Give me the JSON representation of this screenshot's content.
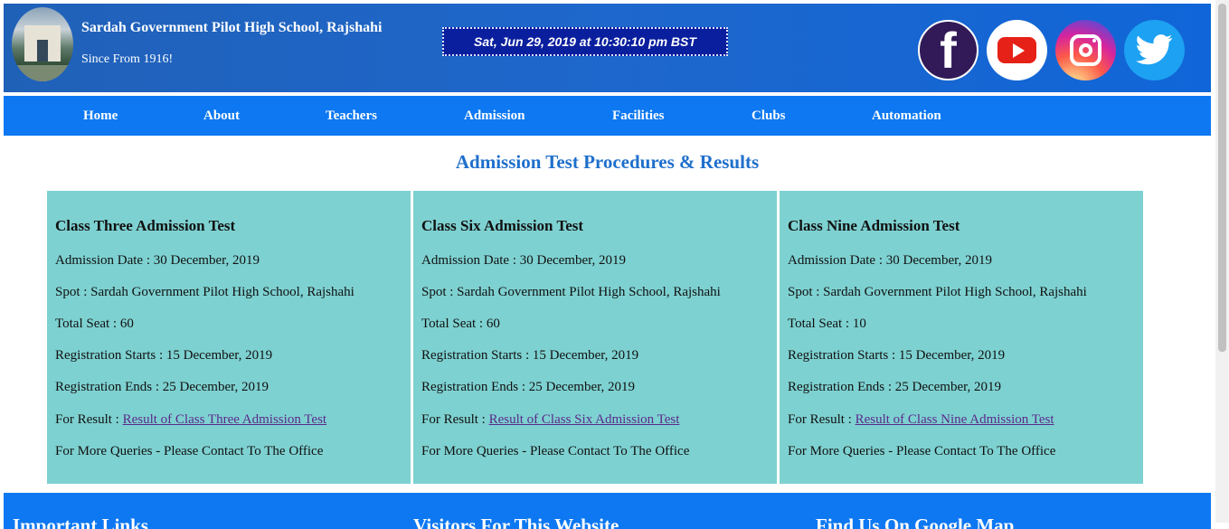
{
  "header": {
    "school_name": "Sardah Government Pilot High School, Rajshahi",
    "since": "Since From 1916!",
    "clock": "Sat, Jun 29, 2019 at 10:30:10 pm BST",
    "social": [
      {
        "name": "facebook-icon",
        "glyph": "f",
        "color": "#311a57"
      },
      {
        "name": "youtube-icon",
        "color": "#e62117"
      },
      {
        "name": "instagram-icon",
        "color": "#d6249f"
      },
      {
        "name": "twitter-icon",
        "color": "#1da1f2"
      }
    ]
  },
  "nav": {
    "items": [
      "Home",
      "About",
      "Teachers",
      "Admission",
      "Facilities",
      "Clubs",
      "Automation"
    ]
  },
  "main": {
    "title": "Admission Test Procedures & Results",
    "cards": [
      {
        "title": "Class Three Admission Test",
        "date": "Admission Date : 30 December, 2019",
        "spot": "Spot : Sardah Government Pilot High School, Rajshahi",
        "seat": "Total Seat : 60",
        "reg_start": "Registration Starts : 15 December, 2019",
        "reg_end": "Registration Ends : 25 December, 2019",
        "result_label": "For Result : ",
        "result_link": "Result of Class Three Admission Test",
        "queries": "For More Queries - Please Contact To The Office"
      },
      {
        "title": "Class Six Admission Test",
        "date": "Admission Date : 30 December, 2019",
        "spot": "Spot : Sardah Government Pilot High School, Rajshahi",
        "seat": "Total Seat : 60",
        "reg_start": "Registration Starts : 15 December, 2019",
        "reg_end": "Registration Ends : 25 December, 2019",
        "result_label": "For Result : ",
        "result_link": "Result of Class Six Admission Test",
        "queries": "For More Queries - Please Contact To The Office"
      },
      {
        "title": "Class Nine Admission Test",
        "date": "Admission Date : 30 December, 2019",
        "spot": "Spot : Sardah Government Pilot High School, Rajshahi",
        "seat": "Total Seat : 10",
        "reg_start": "Registration Starts : 15 December, 2019",
        "reg_end": "Registration Ends : 25 December, 2019",
        "result_label": "For Result : ",
        "result_link": "Result of Class Nine Admission Test",
        "queries": "For More Queries - Please Contact To The Office"
      }
    ]
  },
  "footer": {
    "headings": [
      "Important Links",
      "Visitors For This Website",
      "Find Us On Google Map"
    ]
  },
  "colors": {
    "header": "#1e67cc",
    "nav": "#0d78f2",
    "card": "#7ed1d1",
    "title": "#1e6fcc",
    "clock_bg": "#0a1f9e"
  }
}
